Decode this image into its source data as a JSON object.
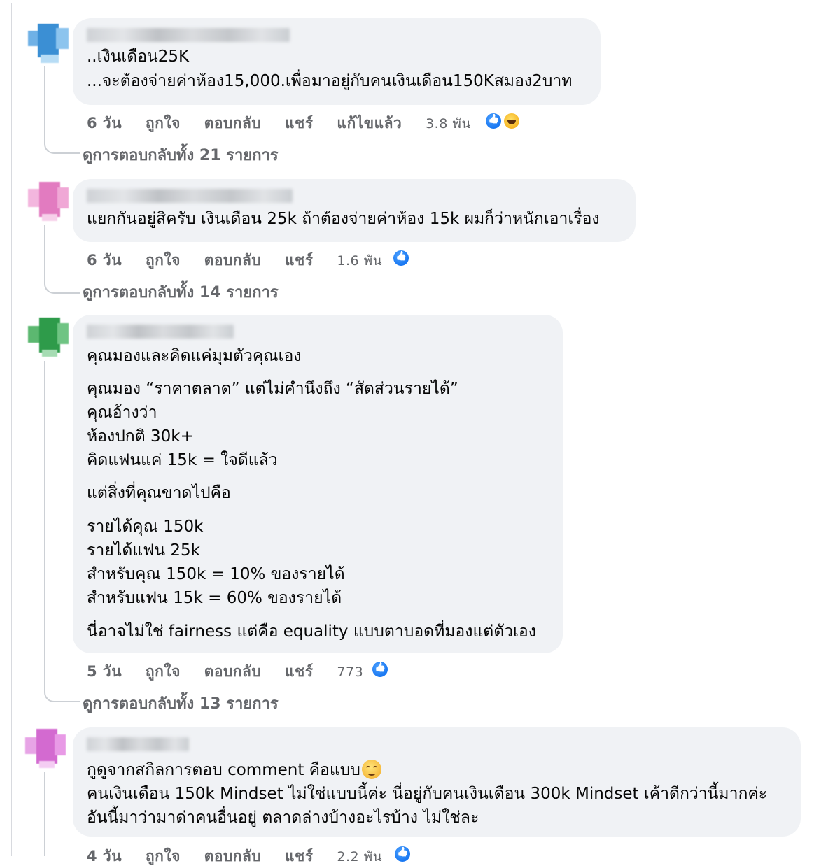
{
  "comments": [
    {
      "lines": [
        "..เงินเดือน25K",
        "...จะต้องจ่ายค่าห้อง15,000.เพื่อมาอยู่กับคนเงินเดือน150Kสมอง2บาท"
      ],
      "time": "6 วัน",
      "like": "ถูกใจ",
      "reply": "ตอบกลับ",
      "share": "แชร์",
      "edited": "แก้ไขแล้ว",
      "reaction_count": "3.8 พัน",
      "view_replies": "ดูการตอบกลับทั้ง 21 รายการ",
      "avatar_color": "#3b8fd4"
    },
    {
      "lines": [
        "แยกกันอยู่สิครับ เงินเดือน 25k ถ้าต้องจ่ายค่าห้อง 15k ผมก็ว่าหนักเอาเรื่อง"
      ],
      "time": "6 วัน",
      "like": "ถูกใจ",
      "reply": "ตอบกลับ",
      "share": "แชร์",
      "reaction_count": "1.6 พัน",
      "view_replies": "ดูการตอบกลับทั้ง 14 รายการ",
      "avatar_color": "#e27bc0"
    },
    {
      "lines": [
        "คุณมองและคิดแค่มุมตัวคุณเอง",
        "คุณมอง “ราคาตลาด” แต่ไม่คำนึงถึง “สัดส่วนรายได้”",
        "คุณอ้างว่า",
        "ห้องปกติ 30k+",
        "คิดแฟนแค่ 15k = ใจดีแล้ว",
        "แต่สิ่งที่คุณขาดไปคือ",
        "รายได้คุณ 150k",
        "รายได้แฟน 25k",
        "สำหรับคุณ 150k = 10% ของรายได้",
        "สำหรับแฟน 15k = 60% ของรายได้",
        "นี่อาจไม่ใช่ fairness แต่คือ equality แบบตาบอดที่มองแต่ตัวเอง"
      ],
      "time": "5 วัน",
      "like": "ถูกใจ",
      "reply": "ตอบกลับ",
      "share": "แชร์",
      "reaction_count": "773",
      "view_replies": "ดูการตอบกลับทั้ง 13 รายการ",
      "avatar_color": "#2e9b4a"
    },
    {
      "lines": [
        "กูดูจากสกิลการตอบ comment คือแบบ",
        "คนเงินเดือน 150k Mindset ไม่ใช่แบบนี้ค่ะ นี่อยู่กับคนเงินเดือน 300k Mindset เค้าดีกว่านี้มากค่ะ",
        "อันนี้มาว่ามาด่าคนอื่นอยู่ ตลาดล่างบ้างอะไรบ้าง ไม่ใช่ละ"
      ],
      "time": "4 วัน",
      "like": "ถูกใจ",
      "reply": "ตอบกลับ",
      "share": "แชร์",
      "reaction_count": "2.2 พัน",
      "avatar_color": "#d36ad0"
    }
  ],
  "icons": {
    "like": "like-reaction-icon",
    "haha": "haha-reaction-icon",
    "emoji": "smiling-face-icon"
  }
}
